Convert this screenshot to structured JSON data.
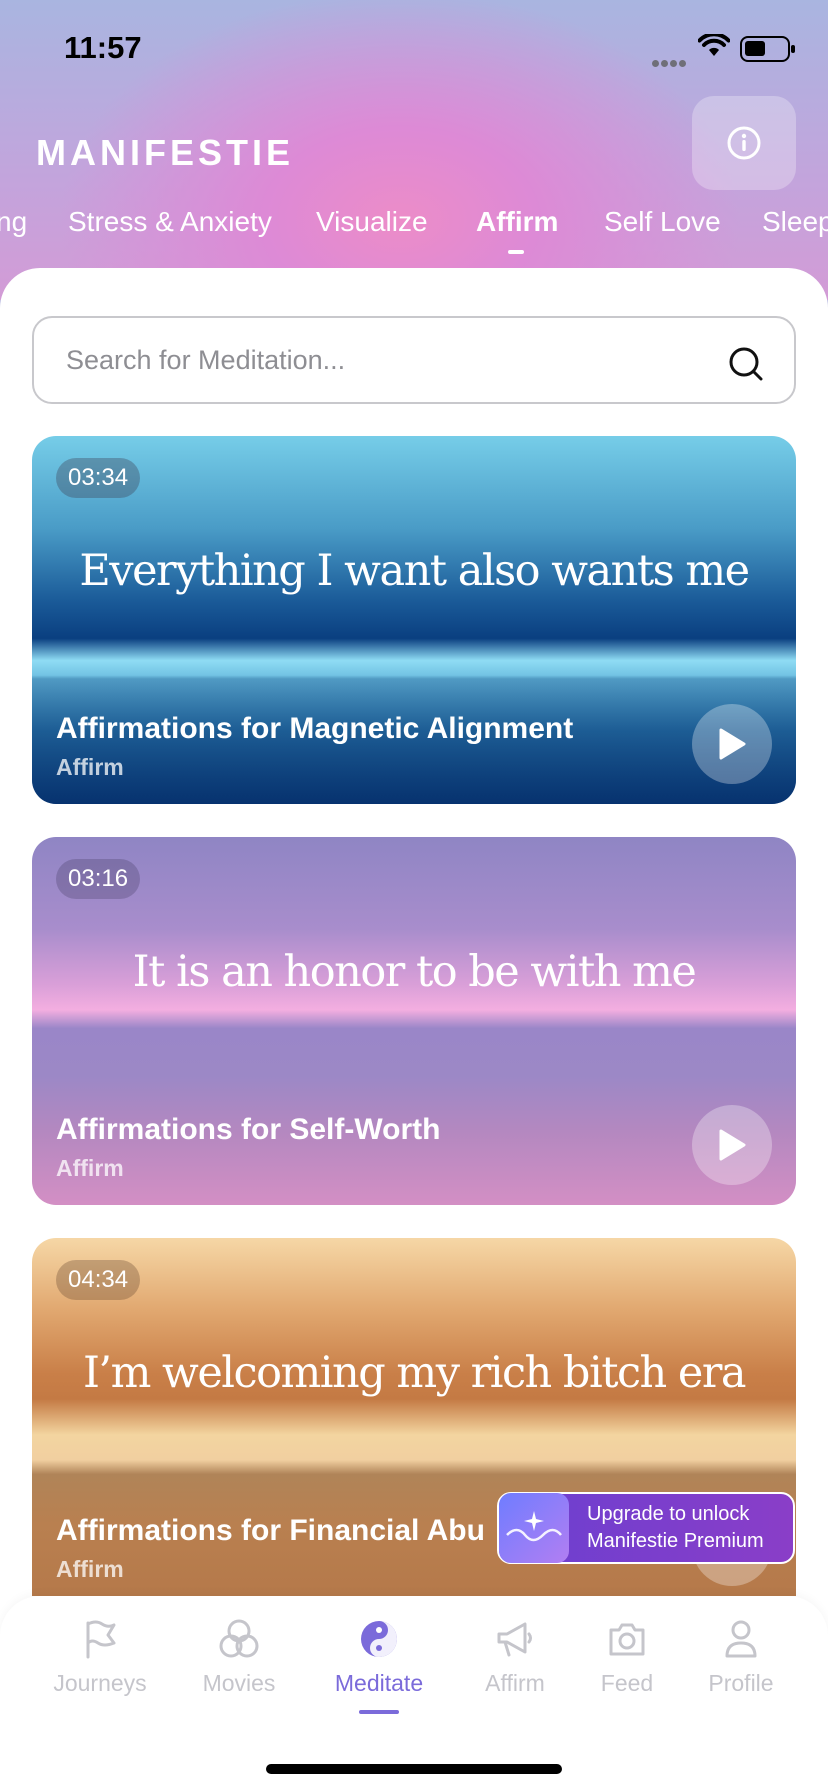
{
  "status_bar": {
    "time": "11:57"
  },
  "app": {
    "logo": "MANIFESTIE"
  },
  "categories": [
    {
      "label": "ng"
    },
    {
      "label": "Stress & Anxiety"
    },
    {
      "label": "Visualize"
    },
    {
      "label": "Affirm",
      "active": true
    },
    {
      "label": "Self Love"
    },
    {
      "label": "Sleep"
    }
  ],
  "search": {
    "placeholder": "Search for Meditation..."
  },
  "cards": [
    {
      "duration": "03:34",
      "quote": "Everything I want also wants me",
      "title": "Affirmations for Magnetic Alignment",
      "category": "Affirm"
    },
    {
      "duration": "03:16",
      "quote": "It is an honor to be with me",
      "title": "Affirmations for Self-Worth",
      "category": "Affirm"
    },
    {
      "duration": "04:34",
      "quote": "I’m welcoming my rich bitch era",
      "title": "Affirmations for Financial Abu",
      "category": "Affirm"
    }
  ],
  "upgrade": {
    "line1": "Upgrade to unlock",
    "line2": "Manifestie Premium"
  },
  "tabbar": [
    {
      "label": "Journeys",
      "icon": "flag-icon"
    },
    {
      "label": "Movies",
      "icon": "circles-icon"
    },
    {
      "label": "Meditate",
      "icon": "yin-yang-icon",
      "active": true
    },
    {
      "label": "Affirm",
      "icon": "megaphone-icon"
    },
    {
      "label": "Feed",
      "icon": "camera-icon"
    },
    {
      "label": "Profile",
      "icon": "person-icon"
    }
  ],
  "colors": {
    "accent": "#7b6bda",
    "inactive_tab": "#c5c5cb"
  }
}
